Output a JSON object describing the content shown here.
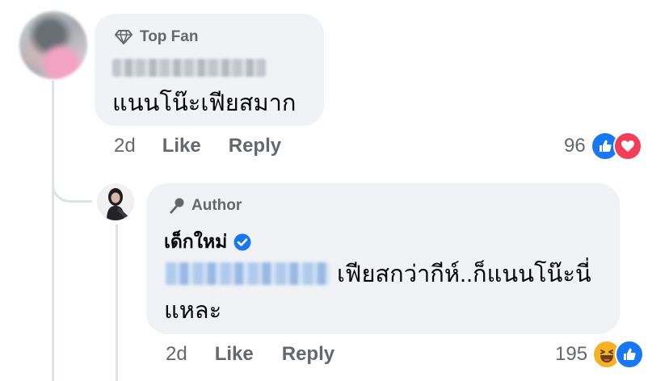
{
  "comment": {
    "badge_label": "Top Fan",
    "text": "แนนโน๊ะเฟียสมาก",
    "time": "2d",
    "like_label": "Like",
    "reply_label": "Reply",
    "reaction_count": "96",
    "reactions": [
      "like-icon",
      "love-icon"
    ]
  },
  "reply": {
    "badge_label": "Author",
    "author_name": "เด็กใหม่",
    "text_line1": "เฟียสกว่ากีห์..ก็แนนโน๊ะนี่",
    "text_line2": "แหละ",
    "time": "2d",
    "like_label": "Like",
    "reply_label": "Reply",
    "reaction_count": "195",
    "reactions": [
      "haha-icon",
      "like-icon"
    ]
  },
  "colors": {
    "bubble": "#f0f2f5",
    "secondary_text": "#65676b",
    "like_blue": "#1877f2",
    "love_red": "#f33e58",
    "haha_yellow": "#f7b125",
    "verified_blue": "#1877f2"
  }
}
